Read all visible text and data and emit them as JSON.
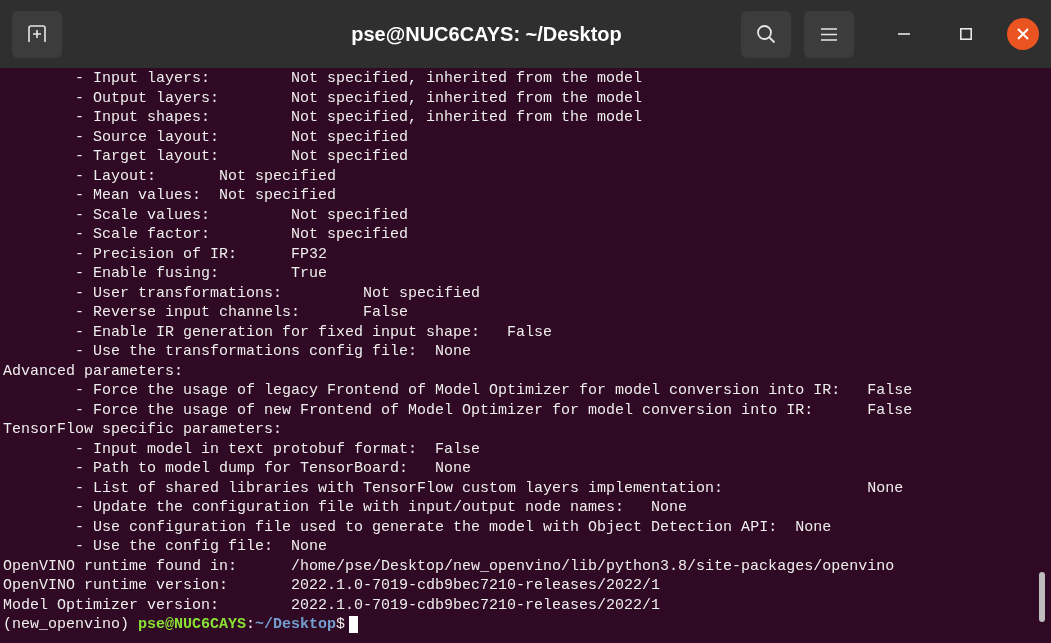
{
  "window": {
    "title": "pse@NUC6CAYS: ~/Desktop"
  },
  "terminal": {
    "lines": [
      "\t- Input layers:\t\tNot specified, inherited from the model",
      "\t- Output layers:\tNot specified, inherited from the model",
      "\t- Input shapes:\t\tNot specified, inherited from the model",
      "\t- Source layout:\tNot specified",
      "\t- Target layout:\tNot specified",
      "\t- Layout:\tNot specified",
      "\t- Mean values:\tNot specified",
      "\t- Scale values:\t\tNot specified",
      "\t- Scale factor:\t\tNot specified",
      "\t- Precision of IR:\tFP32",
      "\t- Enable fusing:\tTrue",
      "\t- User transformations:\t\tNot specified",
      "\t- Reverse input channels:\tFalse",
      "\t- Enable IR generation for fixed input shape:\tFalse",
      "\t- Use the transformations config file:  None",
      "Advanced parameters:",
      "\t- Force the usage of legacy Frontend of Model Optimizer for model conversion into IR:\tFalse",
      "\t- Force the usage of new Frontend of Model Optimizer for model conversion into IR:\tFalse",
      "TensorFlow specific parameters:",
      "\t- Input model in text protobuf format:  False",
      "\t- Path to model dump for TensorBoard:   None",
      "\t- List of shared libraries with TensorFlow custom layers implementation:\t\tNone",
      "\t- Update the configuration file with input/output node names:   None",
      "\t- Use configuration file used to generate the model with Object Detection API:  None",
      "\t- Use the config file:  None",
      "OpenVINO runtime found in:\t/home/pse/Desktop/new_openvino/lib/python3.8/site-packages/openvino",
      "OpenVINO runtime version:\t2022.1.0-7019-cdb9bec7210-releases/2022/1",
      "Model Optimizer version:\t2022.1.0-7019-cdb9bec7210-releases/2022/1"
    ],
    "prompt": {
      "env": "(new_openvino)",
      "user_host": "pse@NUC6CAYS",
      "separator": ":",
      "path": "~/Desktop",
      "symbol": "$"
    }
  }
}
